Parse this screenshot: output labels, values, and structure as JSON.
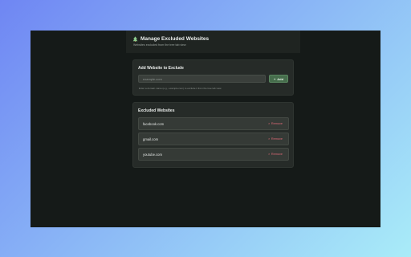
{
  "header": {
    "title": "Manage Excluded Websites",
    "subtitle": "Websites excluded from the tree tab view"
  },
  "add_card": {
    "title": "Add Website to Exclude",
    "input_value": "",
    "input_placeholder": "example.com",
    "add_label": "Add",
    "hint": "Enter a domain name (e.g., example.com) to exclude it from the tree tab view"
  },
  "list_card": {
    "title": "Excluded Websites",
    "remove_label": "Remove",
    "items": [
      {
        "domain": "facebook.com"
      },
      {
        "domain": "gmail.com"
      },
      {
        "domain": "youtube.com"
      }
    ]
  },
  "colors": {
    "page_gradient_start": "#6f86f3",
    "page_gradient_end": "#a9ecf8",
    "window_bg": "#151a18",
    "card_bg": "#262b28",
    "accent_green": "#466d4c",
    "remove_red": "#e06a78"
  },
  "icons": {
    "header": "tree-icon",
    "add": "plus-icon",
    "remove": "close-icon"
  }
}
